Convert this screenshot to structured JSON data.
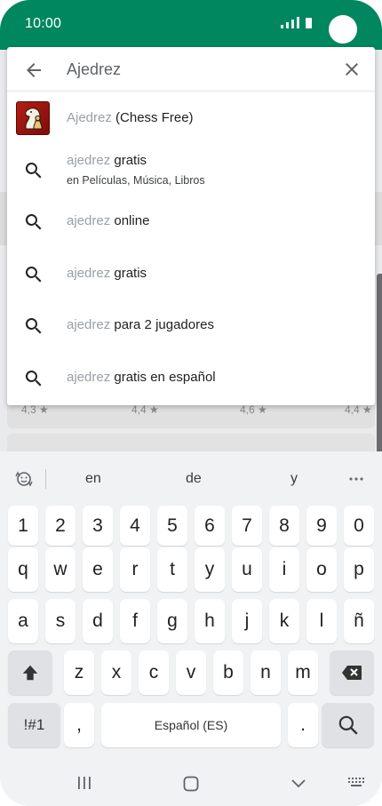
{
  "status_bar": {
    "time": "10:00",
    "colors": {
      "app_green": "#01875f"
    }
  },
  "search": {
    "query": "Ajedrez",
    "back_icon": "arrow-back-icon",
    "clear_icon": "close-icon"
  },
  "suggestions": [
    {
      "icon": "app-icon",
      "query": "Ajedrez",
      "rest": " (Chess Free)"
    },
    {
      "icon": "search-icon",
      "query": "ajedrez",
      "rest": " gratis",
      "sub": "en Películas, Música, Libros"
    },
    {
      "icon": "search-icon",
      "query": "ajedrez",
      "rest": " online"
    },
    {
      "icon": "search-icon",
      "query": "ajedrez",
      "rest": " gratis"
    },
    {
      "icon": "search-icon",
      "query": "ajedrez",
      "rest": " para 2 jugadores"
    },
    {
      "icon": "search-icon",
      "query": "ajedrez",
      "rest": " gratis en español"
    }
  ],
  "background": {
    "ratings": [
      "4,3 ★",
      "4,4 ★",
      "4,6 ★",
      "4,4 ★"
    ]
  },
  "keyboard": {
    "predictions": [
      "en",
      "de",
      "y"
    ],
    "row_numbers": [
      "1",
      "2",
      "3",
      "4",
      "5",
      "6",
      "7",
      "8",
      "9",
      "0"
    ],
    "row_top": [
      "q",
      "w",
      "e",
      "r",
      "t",
      "y",
      "u",
      "i",
      "o",
      "p"
    ],
    "row_middle": [
      "a",
      "s",
      "d",
      "f",
      "g",
      "h",
      "j",
      "k",
      "l",
      "ñ"
    ],
    "row_bottom": [
      "z",
      "x",
      "c",
      "v",
      "b",
      "n",
      "m"
    ],
    "symbols_key": "!#1",
    "comma_key": ",",
    "space_key": "Español (ES)",
    "period_key": ".",
    "shift_icon": "shift-icon",
    "backspace_icon": "backspace-icon",
    "search_key_icon": "search-icon"
  },
  "nav": {
    "recent_icon": "recent-apps-icon",
    "home_icon": "home-icon",
    "back_icon": "chevron-down-icon",
    "keyboard_icon": "keyboard-icon"
  }
}
